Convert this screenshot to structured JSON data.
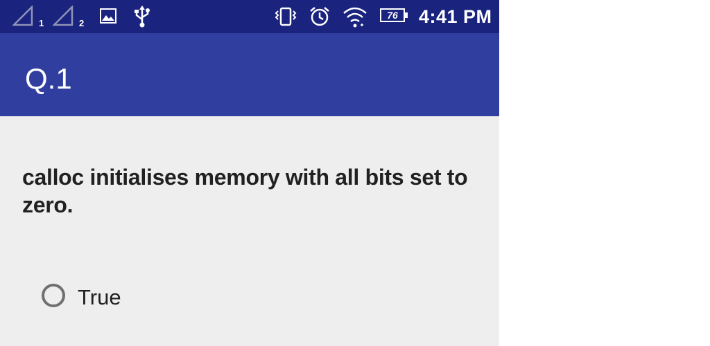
{
  "status_bar": {
    "sim1_label": "1",
    "sim2_label": "2",
    "icons": [
      "signal-icon",
      "signal-icon",
      "gallery-icon",
      "usb-icon",
      "vibrate-icon",
      "alarm-icon",
      "wifi-icon",
      "battery-icon"
    ],
    "battery_level": "76",
    "time": "4:41 PM"
  },
  "app_bar": {
    "title": "Q.1",
    "color": "#303f9f"
  },
  "question": {
    "text": "calloc initialises memory with all bits set to zero."
  },
  "options": [
    {
      "label": "True",
      "selected": false
    }
  ],
  "colors": {
    "status_bar": "#1a237e",
    "app_bar": "#303f9f",
    "background": "#eeeeee",
    "text": "#212121"
  }
}
